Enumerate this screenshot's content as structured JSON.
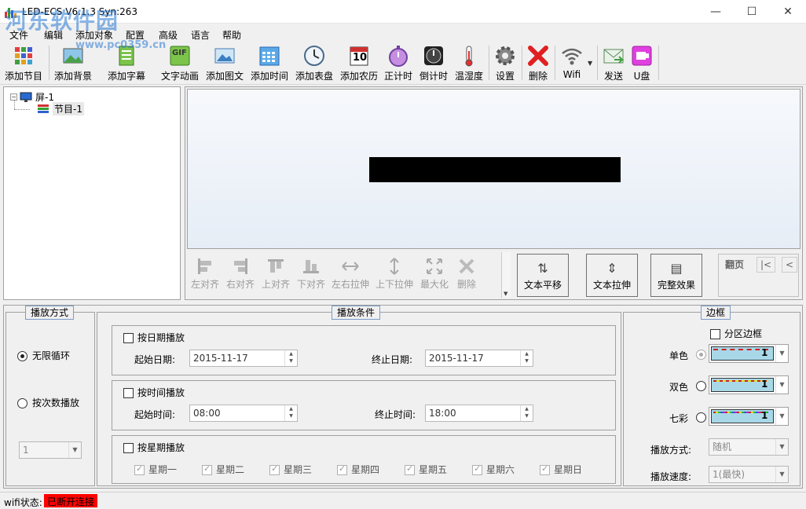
{
  "window": {
    "title": "LED-ECS V6.1.3 Syn:263",
    "watermark": "河东软件园",
    "watermark_url": "www.pc0359.cn",
    "minimize": "—",
    "maximize": "☐",
    "close": "✕"
  },
  "menu": [
    "文件",
    "编辑",
    "添加对象",
    "配置",
    "高级",
    "语言",
    "帮助"
  ],
  "toolbar": {
    "add_program": "添加节目",
    "add_background": "添加背景",
    "add_subtitle": "添加字幕",
    "text_animation": "文字动画",
    "add_picture": "添加图文",
    "add_time": "添加时间",
    "add_clock": "添加表盘",
    "add_calendar": "添加农历",
    "countup": "正计时",
    "countdown": "倒计时",
    "temperature": "温湿度",
    "settings": "设置",
    "delete": "删除",
    "wifi": "Wifi",
    "send": "发送",
    "udisk": "U盘",
    "calendar_day": "10",
    "gif_label": "GIF"
  },
  "tree": {
    "screen": "屏-1",
    "program": "节目-1",
    "collapse": "−"
  },
  "align": {
    "left": "左对齐",
    "right": "右对齐",
    "top": "上对齐",
    "bottom": "下对齐",
    "hstretch": "左右拉伸",
    "vstretch": "上下拉伸",
    "maximize": "最大化",
    "delete": "删除"
  },
  "actions": {
    "text_pan": "文本平移",
    "text_stretch": "文本拉伸",
    "full_effect": "完整效果",
    "page_label": "翻页",
    "first_page": "|<",
    "prev_page": "<"
  },
  "play_mode": {
    "title": "播放方式",
    "infinite": "无限循环",
    "by_count": "按次数播放",
    "count_value": "1"
  },
  "play_cond": {
    "title": "播放条件",
    "by_date": "按日期播放",
    "start_date_label": "起始日期:",
    "start_date": "2015-11-17",
    "end_date_label": "终止日期:",
    "end_date": "2015-11-17",
    "by_time": "按时间播放",
    "start_time_label": "起始时间:",
    "start_time": "08:00",
    "end_time_label": "终止时间:",
    "end_time": "18:00",
    "by_week": "按星期播放",
    "weekdays": [
      "星期一",
      "星期二",
      "星期三",
      "星期四",
      "星期五",
      "星期六",
      "星期日"
    ]
  },
  "border": {
    "title": "边框",
    "zone_border": "分区边框",
    "single": "单色",
    "double": "双色",
    "seven": "七彩",
    "single_value": "1",
    "double_value": "1",
    "seven_value": "1",
    "play_mode_label": "播放方式:",
    "play_mode_value": "随机",
    "speed_label": "播放速度:",
    "speed_value": "1(最快)"
  },
  "status": {
    "wifi_label": "wifi状态:",
    "wifi_value": "已断开连接",
    "wifi_color": "#ff0000"
  }
}
